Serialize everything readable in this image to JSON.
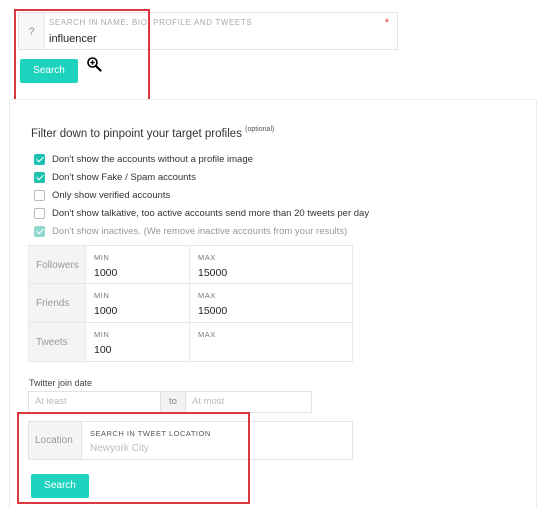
{
  "search": {
    "help_glyph": "?",
    "label": "SEARCH IN NAME, BIO, PROFILE AND TWEETS",
    "value": "influencer",
    "required_mark": "*",
    "button_label": "Search"
  },
  "filters": {
    "title": "Filter down to pinpoint your target profiles",
    "title_note": "(optional)",
    "checkboxes": [
      {
        "label": "Don't show the accounts without a profile image",
        "checked": true
      },
      {
        "label": "Don't show Fake / Spam accounts",
        "checked": true
      },
      {
        "label": "Only show verified accounts",
        "checked": false
      },
      {
        "label": "Don't show talkative, too active accounts send more than 20 tweets per day",
        "checked": false
      },
      {
        "label": "Don't show inactives. (We remove inactive accounts from your results)",
        "checked": true,
        "disabled": true
      }
    ],
    "ranges": [
      {
        "label": "Followers",
        "min_label": "MIN",
        "min": "1000",
        "max_label": "MAX",
        "max": "15000"
      },
      {
        "label": "Friends",
        "min_label": "MIN",
        "min": "1000",
        "max_label": "MAX",
        "max": "15000"
      },
      {
        "label": "Tweets",
        "min_label": "MIN",
        "min": "100",
        "max_label": "MAX",
        "max": ""
      }
    ],
    "join_date": {
      "label": "Twitter join date",
      "from_placeholder": "At least",
      "separator": "to",
      "to_placeholder": "At most"
    },
    "location": {
      "label": "Location",
      "field_label": "SEARCH IN TWEET LOCATION",
      "placeholder": "Newyork City"
    },
    "button_label": "Search"
  },
  "colors": {
    "accent": "#1ed3be",
    "highlight": "#d9363e"
  },
  "icons": {
    "zoom": "zoom-in-icon"
  }
}
